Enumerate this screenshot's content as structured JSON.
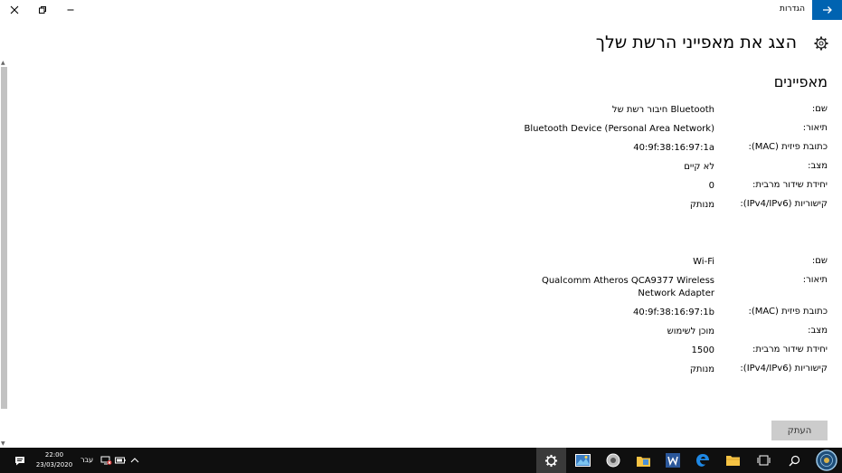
{
  "window": {
    "app_title": "הגדרות",
    "page_title": "הצג את מאפייני הרשת שלך",
    "section_title": "מאפיינים"
  },
  "adapters": [
    {
      "rows": [
        {
          "label": "שם:",
          "value": "חיבור רשת של Bluetooth"
        },
        {
          "label": "תיאור:",
          "value": "Bluetooth Device (Personal Area Network)"
        },
        {
          "label": "כתובת פיזית (MAC):",
          "value": "40:9f:38:16:97:1a"
        },
        {
          "label": "מצב:",
          "value": "לא קיים"
        },
        {
          "label": "יחידת שידור מרבית:",
          "value": "0"
        },
        {
          "label": "קישוריות (IPv4/IPv6):",
          "value": "מנותק"
        }
      ]
    },
    {
      "rows": [
        {
          "label": "שם:",
          "value": "Wi-Fi"
        },
        {
          "label": "תיאור:",
          "value": "Qualcomm Atheros QCA9377 Wireless",
          "value2": "Network Adapter"
        },
        {
          "label": "כתובת פיזית (MAC):",
          "value": "40:9f:38:16:97:1b"
        },
        {
          "label": "מצב:",
          "value": "מוכן לשימוש"
        },
        {
          "label": "יחידת שידור מרבית:",
          "value": "1500"
        },
        {
          "label": "קישוריות (IPv4/IPv6):",
          "value": "מנותק"
        }
      ]
    }
  ],
  "copy_button": {
    "label": "העתק"
  },
  "taskbar": {
    "time": "22:00",
    "date": "23/03/2020",
    "language": "עבר"
  },
  "colors": {
    "accent": "#0063b1",
    "taskbar": "#0f0f0f",
    "copy_button": "#cccccc"
  }
}
